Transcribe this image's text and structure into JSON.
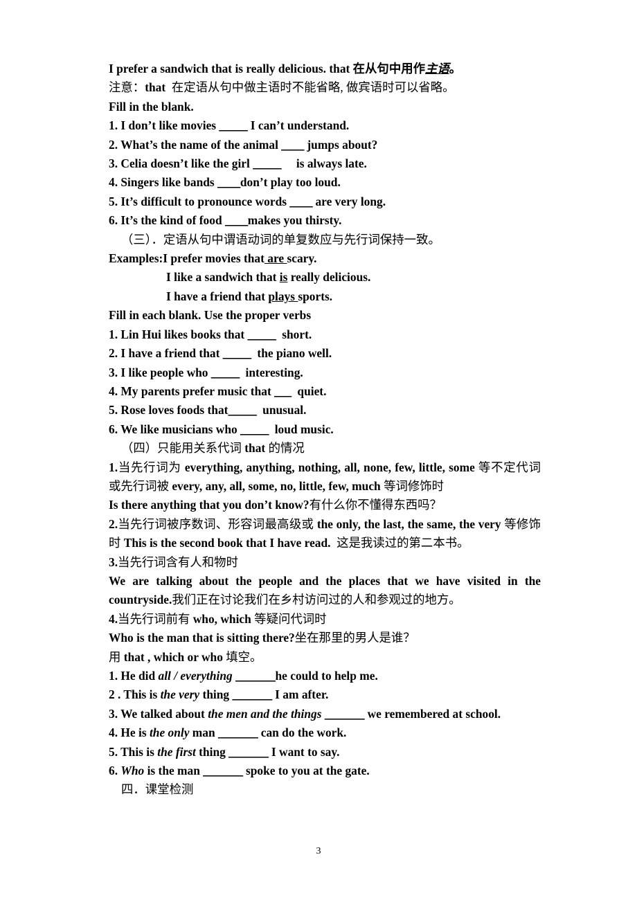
{
  "document": {
    "page_number": "3",
    "lines": [
      {
        "id": "l1",
        "segments": [
          {
            "t": "I prefer a sandwich that is really delicious. that 在从句中用作",
            "s": "b"
          },
          {
            "t": "主语",
            "s": "uit"
          },
          {
            "t": "。",
            "s": "b"
          }
        ]
      },
      {
        "id": "l2",
        "segments": [
          {
            "t": "注意：",
            "s": "cn"
          },
          {
            "t": "that ",
            "s": "b"
          },
          {
            "t": " 在定语从句中做主语时不能省略, 做宾语时可以省略。",
            "s": "cn"
          }
        ]
      },
      {
        "id": "l3",
        "segments": [
          {
            "t": "Fill in the blank.",
            "s": "b"
          }
        ]
      },
      {
        "id": "l4",
        "segments": [
          {
            "t": "1. I don’t like movies ",
            "s": "b"
          },
          {
            "t": "_____",
            "s": "blank"
          },
          {
            "t": " I can’t understand.",
            "s": "b"
          }
        ]
      },
      {
        "id": "l5",
        "segments": [
          {
            "t": "2. What’s the name of the animal ",
            "s": "b"
          },
          {
            "t": "____",
            "s": "blank"
          },
          {
            "t": " jumps about?",
            "s": "b"
          }
        ]
      },
      {
        "id": "l6",
        "segments": [
          {
            "t": "3. Celia doesn’t like the girl ",
            "s": "b"
          },
          {
            "t": "_____",
            "s": "blank"
          },
          {
            "t": "     is always late.",
            "s": "b"
          }
        ]
      },
      {
        "id": "l7",
        "segments": [
          {
            "t": "4. Singers like bands ",
            "s": "b"
          },
          {
            "t": "____",
            "s": "blank"
          },
          {
            "t": "don’t play too loud.",
            "s": "b"
          }
        ]
      },
      {
        "id": "l8",
        "segments": [
          {
            "t": "5. It’s difficult to pronounce words ",
            "s": "b"
          },
          {
            "t": "____",
            "s": "blank"
          },
          {
            "t": " are very long.",
            "s": "b"
          }
        ]
      },
      {
        "id": "l9",
        "segments": [
          {
            "t": "6. It’s the kind of food ",
            "s": "b"
          },
          {
            "t": "____",
            "s": "blank"
          },
          {
            "t": "makes you thirsty.",
            "s": "b"
          }
        ]
      },
      {
        "id": "l10",
        "indent": "head",
        "segments": [
          {
            "t": "（三）．定语从句中谓语动词的单复数应与先行词保持一致。",
            "s": "cn"
          }
        ]
      },
      {
        "id": "l11",
        "segments": [
          {
            "t": "Examples:I prefer movies that",
            "s": "b"
          },
          {
            "t": " are ",
            "s": "u"
          },
          {
            "t": "scary.",
            "s": "b"
          }
        ]
      },
      {
        "id": "l12",
        "indent": "example",
        "segments": [
          {
            "t": "I like a sandwich that ",
            "s": "b"
          },
          {
            "t": "is",
            "s": "u"
          },
          {
            "t": " really delicious.",
            "s": "b"
          }
        ]
      },
      {
        "id": "l13",
        "indent": "example",
        "segments": [
          {
            "t": "I have a friend that ",
            "s": "b"
          },
          {
            "t": "plays ",
            "s": "u"
          },
          {
            "t": "sports.",
            "s": "b"
          }
        ]
      },
      {
        "id": "l14",
        "segments": [
          {
            "t": "Fill in each blank. Use the proper verbs",
            "s": "b"
          }
        ]
      },
      {
        "id": "l15",
        "segments": [
          {
            "t": "1. Lin Hui likes books that ",
            "s": "b"
          },
          {
            "t": "_____",
            "s": "blank"
          },
          {
            "t": "  short.",
            "s": "b"
          }
        ]
      },
      {
        "id": "l16",
        "segments": [
          {
            "t": "2. I have a friend that ",
            "s": "b"
          },
          {
            "t": "_____",
            "s": "blank"
          },
          {
            "t": "  the piano well.",
            "s": "b"
          }
        ]
      },
      {
        "id": "l17",
        "segments": [
          {
            "t": "3. I like people who ",
            "s": "b"
          },
          {
            "t": "_____",
            "s": "blank"
          },
          {
            "t": "  interesting.",
            "s": "b"
          }
        ]
      },
      {
        "id": "l18",
        "segments": [
          {
            "t": "4. My parents prefer music that ",
            "s": "b"
          },
          {
            "t": "___",
            "s": "blank"
          },
          {
            "t": "  quiet.",
            "s": "b"
          }
        ]
      },
      {
        "id": "l19",
        "segments": [
          {
            "t": "5. Rose loves foods that",
            "s": "b"
          },
          {
            "t": "_____",
            "s": "blank"
          },
          {
            "t": "  unusual.",
            "s": "b"
          }
        ]
      },
      {
        "id": "l20",
        "segments": [
          {
            "t": "6. We like musicians who ",
            "s": "b"
          },
          {
            "t": "_____",
            "s": "blank"
          },
          {
            "t": "  loud music.",
            "s": "b"
          }
        ]
      },
      {
        "id": "l21",
        "indent": "head",
        "segments": [
          {
            "t": "（四）只能用关系代词 ",
            "s": "cn"
          },
          {
            "t": "that",
            "s": "b"
          },
          {
            "t": " 的情况",
            "s": "cn"
          }
        ]
      },
      {
        "id": "l22",
        "justify": true,
        "segments": [
          {
            "t": "1.",
            "s": "b"
          },
          {
            "t": "当先行词为 ",
            "s": "cn"
          },
          {
            "t": "everything, anything, nothing, all, none, few, little, some",
            "s": "b"
          },
          {
            "t": " 等不定代词或先行词被 ",
            "s": "cn"
          },
          {
            "t": "every, any, all, some, no, little, few, much",
            "s": "b"
          },
          {
            "t": " 等词修饰时",
            "s": "cn"
          }
        ]
      },
      {
        "id": "l23",
        "segments": [
          {
            "t": "Is there anything that you don’t know?",
            "s": "b"
          },
          {
            "t": "有什么你不懂得东西吗？",
            "s": "cn"
          }
        ]
      },
      {
        "id": "l24",
        "justify": true,
        "segments": [
          {
            "t": "2.",
            "s": "b"
          },
          {
            "t": "当先行词被序数词、形容词最高级或 ",
            "s": "cn"
          },
          {
            "t": "the only, the last, the same, the very",
            "s": "b"
          },
          {
            "t": " 等修饰时 ",
            "s": "cn"
          },
          {
            "t": "This is the second book that I have read.",
            "s": "b"
          },
          {
            "t": "  这是我读过的第二本书。",
            "s": "cn"
          }
        ]
      },
      {
        "id": "l25",
        "segments": [
          {
            "t": "3.",
            "s": "b"
          },
          {
            "t": "当先行词含有人和物时",
            "s": "cn"
          }
        ]
      },
      {
        "id": "l26",
        "justify": true,
        "segments": [
          {
            "t": "We are talking about the people and the places that we have visited in the countryside.",
            "s": "b"
          },
          {
            "t": "我们正在讨论我们在乡村访问过的人和参观过的地方。",
            "s": "cn"
          }
        ]
      },
      {
        "id": "l27",
        "segments": [
          {
            "t": "4.",
            "s": "b"
          },
          {
            "t": "当先行词前有 ",
            "s": "cn"
          },
          {
            "t": "who, which",
            "s": "b"
          },
          {
            "t": " 等疑问代词时",
            "s": "cn"
          }
        ]
      },
      {
        "id": "l28",
        "segments": [
          {
            "t": "Who is the man that is sitting there?",
            "s": "b"
          },
          {
            "t": "坐在那里的男人是谁？",
            "s": "cn"
          }
        ]
      },
      {
        "id": "l29",
        "segments": [
          {
            "t": "用 ",
            "s": "cn"
          },
          {
            "t": "that , which or who",
            "s": "b"
          },
          {
            "t": " 填空。",
            "s": "cn"
          }
        ]
      },
      {
        "id": "l30",
        "segments": [
          {
            "t": "1. He did ",
            "s": "b"
          },
          {
            "t": "all / everything",
            "s": "it"
          },
          {
            "t": " ",
            "s": "b"
          },
          {
            "t": "_______",
            "s": "blank"
          },
          {
            "t": "he could to help me.",
            "s": "b"
          }
        ]
      },
      {
        "id": "l31",
        "segments": [
          {
            "t": "2 . This is ",
            "s": "b"
          },
          {
            "t": "the very",
            "s": "it"
          },
          {
            "t": " thing ",
            "s": "b"
          },
          {
            "t": "_______",
            "s": "blank"
          },
          {
            "t": " I am after.",
            "s": "b"
          }
        ]
      },
      {
        "id": "l32",
        "segments": [
          {
            "t": "3. We talked about ",
            "s": "b"
          },
          {
            "t": "the men and the things",
            "s": "it"
          },
          {
            "t": " ",
            "s": "b"
          },
          {
            "t": "_______",
            "s": "blank"
          },
          {
            "t": " we remembered at school.",
            "s": "b"
          }
        ]
      },
      {
        "id": "l33",
        "segments": [
          {
            "t": "4. He is ",
            "s": "b"
          },
          {
            "t": "the only",
            "s": "it"
          },
          {
            "t": " man ",
            "s": "b"
          },
          {
            "t": "_______",
            "s": "blank"
          },
          {
            "t": " can do the work.",
            "s": "b"
          }
        ]
      },
      {
        "id": "l34",
        "segments": [
          {
            "t": "5. This is ",
            "s": "b"
          },
          {
            "t": "the first",
            "s": "it"
          },
          {
            "t": " thing ",
            "s": "b"
          },
          {
            "t": "_______",
            "s": "blank"
          },
          {
            "t": " I want to say.",
            "s": "b"
          }
        ]
      },
      {
        "id": "l35",
        "segments": [
          {
            "t": "6. ",
            "s": "b"
          },
          {
            "t": "Who",
            "s": "it"
          },
          {
            "t": " is the man ",
            "s": "b"
          },
          {
            "t": "_______",
            "s": "blank"
          },
          {
            "t": " spoke to you at the gate.",
            "s": "b"
          }
        ]
      },
      {
        "id": "l36",
        "indent": "head",
        "segments": [
          {
            "t": "四．课堂检测",
            "s": "cn"
          }
        ]
      }
    ]
  }
}
